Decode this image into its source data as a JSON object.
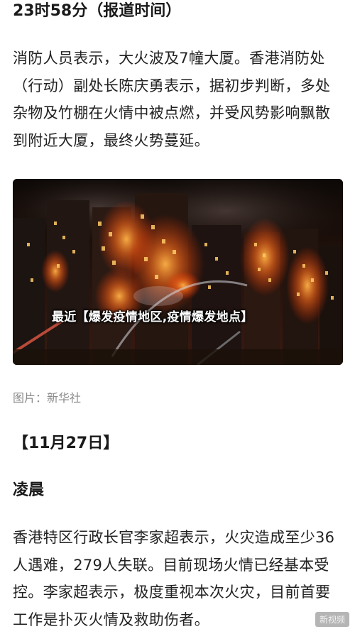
{
  "article": {
    "time_heading": "23时58分（报道时间）",
    "paragraph_1": "消防人员表示，大火波及7幢大厦。香港消防处（行动）副处长陈庆勇表示，据初步判断，多处杂物及竹棚在火情中被点燃，并受风势影响飘散到附近大厦，最终火势蔓延。",
    "photo": {
      "overlay_caption": "最近【爆发疫情地区,疫情爆发地点】",
      "credit": "图片：新华社"
    },
    "date_heading": "【11月27日】",
    "section_heading": "凌晨",
    "paragraph_2": "香港特区行政长官李家超表示，火灾造成至少36人遇难，279人失联。目前现场火情已经基本受控。李家超表示，极度重视本次火灾，目前首要工作是扑灭火情及救助伤者。",
    "watermark": "新视频"
  }
}
